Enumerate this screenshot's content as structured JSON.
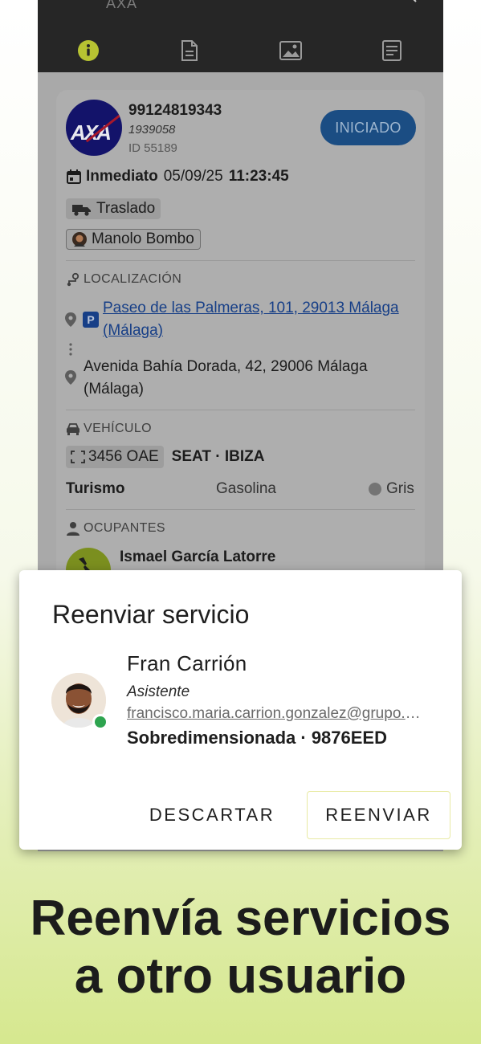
{
  "appbar": {
    "title": "AXA",
    "tabs": [
      {
        "name": "info",
        "active": true
      },
      {
        "name": "documents",
        "active": false
      },
      {
        "name": "images",
        "active": false
      },
      {
        "name": "notes",
        "active": false
      }
    ],
    "active_color": "#b7c332"
  },
  "service": {
    "number": "99124819343",
    "reference": "1939058",
    "id_label": "ID 55189",
    "status": "INICIADO",
    "logo_text": "AXA",
    "priority": "Inmediato",
    "date": "05/09/25",
    "time": "11:23:45",
    "service_type": "Traslado",
    "assignee": "Manolo Bombo"
  },
  "location": {
    "section_title": "LOCALIZACIÓN",
    "parking_badge": "P",
    "origin_line1": "Paseo de las Palmeras, 101, 29013 Málaga",
    "origin_line2": "(Málaga)",
    "destination_line1": "Avenida Bahía Dorada, 42, 29006 Málaga",
    "destination_line2": "(Málaga)"
  },
  "vehicle": {
    "section_title": "VEHÍCULO",
    "plate": "3456 OAE",
    "model": "SEAT · IBIZA",
    "type": "Turismo",
    "fuel": "Gasolina",
    "color": "Gris"
  },
  "occupants": {
    "section_title": "OCUPANTES",
    "first_name": "Ismael García Latorre"
  },
  "dialog": {
    "title": "Reenviar servicio",
    "user_name": "Fran Carrión",
    "user_role": "Asistente",
    "user_email": "francisco.maria.carrion.gonzalez@grupo.com",
    "user_vehicle": "Sobredimensionada · 9876EED",
    "discard_label": "DESCARTAR",
    "forward_label": "REENVIAR",
    "online_color": "#2ea44f"
  },
  "headline": {
    "line1": "Reenvía servicios",
    "line2": "a otro usuario"
  }
}
